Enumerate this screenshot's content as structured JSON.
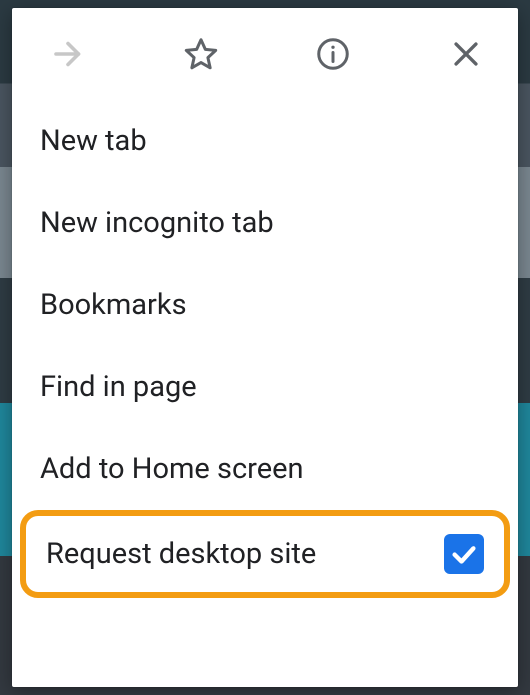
{
  "menu": {
    "items": [
      {
        "label": "New tab"
      },
      {
        "label": "New incognito tab"
      },
      {
        "label": "Bookmarks"
      },
      {
        "label": "Find in page"
      },
      {
        "label": "Add to Home screen"
      },
      {
        "label": "Request desktop site",
        "checked": true,
        "highlighted": true
      }
    ]
  },
  "colors": {
    "highlight_border": "#f39c12",
    "checkbox_fill": "#1a73e8"
  }
}
